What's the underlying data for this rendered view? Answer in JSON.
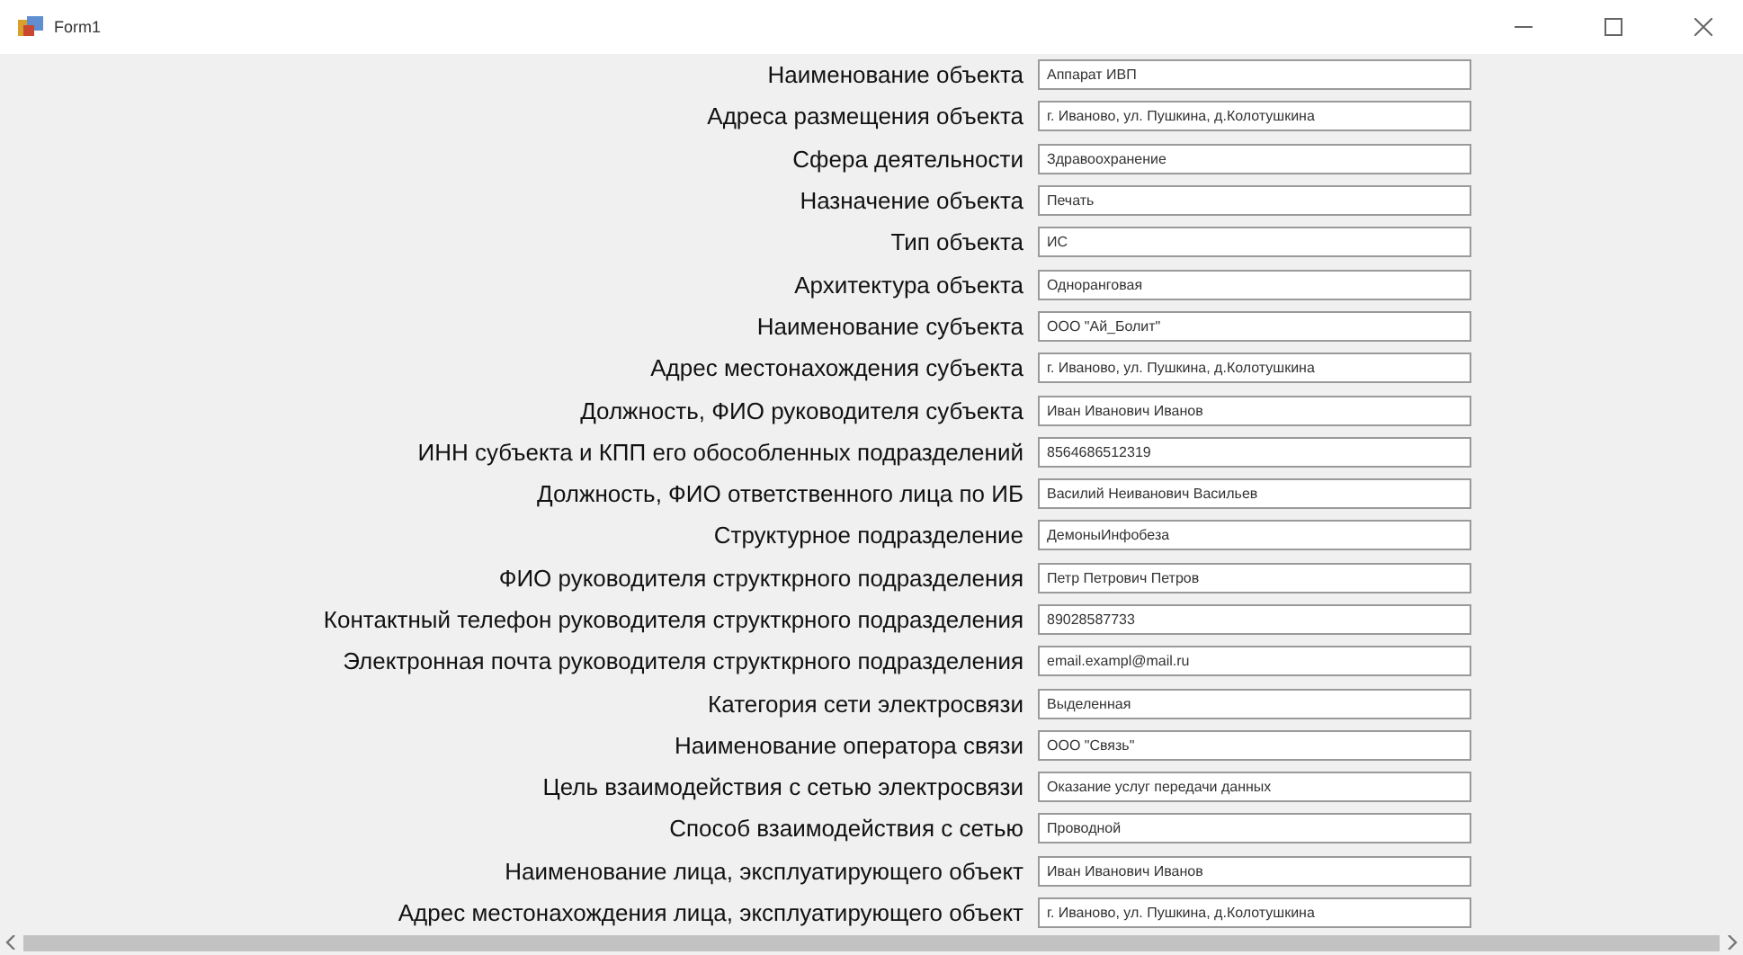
{
  "window": {
    "title": "Form1"
  },
  "fields": [
    {
      "label": "Наименование объекта",
      "value": "Аппарат ИВП"
    },
    {
      "label": "Адреса размещения объекта",
      "value": "г. Иваново, ул. Пушкина, д.Колотушкина"
    },
    {
      "label": "Сфера деятельности",
      "value": "Здравоохранение"
    },
    {
      "label": "Назначение объекта",
      "value": "Печать"
    },
    {
      "label": "Тип объекта",
      "value": "ИС"
    },
    {
      "label": "Архитектура объекта",
      "value": "Одноранговая"
    },
    {
      "label": "Наименование субъекта",
      "value": "ООО \"Ай_Болит\""
    },
    {
      "label": "Адрес местонахождения субъекта",
      "value": "г. Иваново, ул. Пушкина, д.Колотушкина"
    },
    {
      "label": "Должность, ФИО руководителя субъекта",
      "value": "Иван Иванович Иванов"
    },
    {
      "label": "ИНН субъекта и КПП его обособленных подразделений",
      "value": "8564686512319"
    },
    {
      "label": "Должность, ФИО ответственного лица по ИБ",
      "value": "Василий Неиванович Васильев"
    },
    {
      "label": "Структурное подразделение",
      "value": "ДемоныИнфобеза"
    },
    {
      "label": "ФИО руководителя структкрного подразделения",
      "value": "Петр Петрович Петров"
    },
    {
      "label": "Контактный телефон руководителя структкрного подразделения",
      "value": "89028587733"
    },
    {
      "label": "Электронная почта руководителя структкрного подразделения",
      "value": "email.exampl@mail.ru"
    },
    {
      "label": "Категория сети электросвязи",
      "value": "Выделенная"
    },
    {
      "label": "Наименование оператора связи",
      "value": "ООО \"Связь\""
    },
    {
      "label": "Цель взаимодействия с сетью электросвязи",
      "value": "Оказание услуг передачи данных"
    },
    {
      "label": "Способ взаимодействия с сетью",
      "value": "Проводной"
    },
    {
      "label": "Наименование лица, эксплуатирующего объект",
      "value": "Иван Иванович Иванов"
    },
    {
      "label": "Адрес местонахождения лица, эксплуатирующего объект",
      "value": "г. Иваново, ул. Пушкина, д.Колотушкина"
    }
  ]
}
